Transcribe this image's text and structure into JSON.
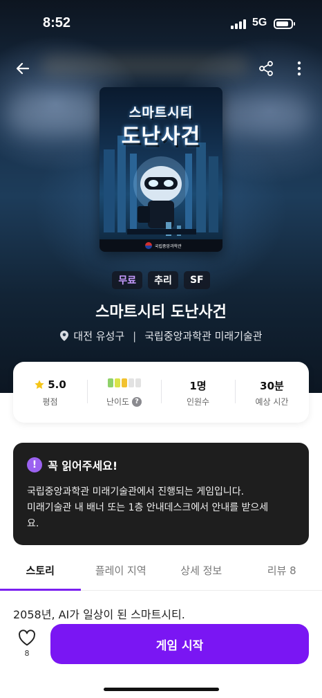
{
  "status_bar": {
    "time": "8:52",
    "network": "5G"
  },
  "cover": {
    "title_line1": "스마트시티",
    "title_line2": "도난사건",
    "organization": "국립중앙과학관"
  },
  "tags": [
    {
      "label": "무료",
      "color": "#c79bff"
    },
    {
      "label": "추리"
    },
    {
      "label": "SF"
    }
  ],
  "title": "스마트시티 도난사건",
  "location": {
    "region": "대전 유성구",
    "place": "국립중앙과학관 미래기술관"
  },
  "stats": {
    "rating": {
      "value": "5.0",
      "label": "평점"
    },
    "difficulty": {
      "level": 3,
      "max": 5,
      "label": "난이도",
      "colors": [
        "#8fd16a",
        "#d9e34a",
        "#f2c230"
      ]
    },
    "players": {
      "value": "1명",
      "label": "인원수"
    },
    "duration": {
      "value": "30분",
      "label": "예상 시간"
    }
  },
  "notice": {
    "title": "꼭 읽어주세요!",
    "line1": "국립중앙과학관 미래기술관에서 진행되는 게임입니다.",
    "line2": "미래기술관 내 배너 또는 1층 안내데스크에서 안내를 받으세",
    "line3": "요."
  },
  "tabs": [
    {
      "label": "스토리",
      "active": true
    },
    {
      "label": "플레이 지역"
    },
    {
      "label": "상세 정보"
    },
    {
      "label": "리뷰 8"
    }
  ],
  "story_preview": "2058년, AI가 일상이 된 스마트시티.",
  "bottom": {
    "like_count": "8",
    "start_label": "게임 시작"
  },
  "colors": {
    "accent": "#7a16f3",
    "notice_bg": "#1e1e1e"
  }
}
